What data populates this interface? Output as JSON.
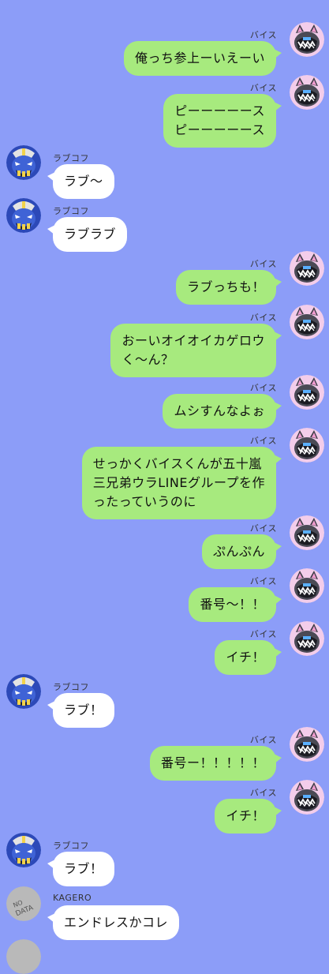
{
  "messages": [
    {
      "side": "right",
      "sender": "バイス",
      "avatar": "pink-cat-creature-icon",
      "text": "俺っち参上ーいえーい"
    },
    {
      "side": "right",
      "sender": "バイス",
      "avatar": "pink-cat-creature-icon",
      "text": "ピーーーーース\nピーーーーース"
    },
    {
      "side": "left",
      "sender": "ラブコフ",
      "avatar": "blue-kaiju-icon",
      "text": "ラブ〜"
    },
    {
      "side": "left",
      "sender": "ラブコフ",
      "avatar": "blue-kaiju-icon",
      "text": "ラブラブ"
    },
    {
      "side": "right",
      "sender": "バイス",
      "avatar": "pink-cat-creature-icon",
      "text": "ラブっちも！"
    },
    {
      "side": "right",
      "sender": "バイス",
      "avatar": "pink-cat-creature-icon",
      "text": "おーいオイオイカゲロウ\nく〜ん？"
    },
    {
      "side": "right",
      "sender": "バイス",
      "avatar": "pink-cat-creature-icon",
      "text": "ムシすんなよぉ"
    },
    {
      "side": "right",
      "sender": "バイス",
      "avatar": "pink-cat-creature-icon",
      "text": "せっかくバイスくんが五十嵐\n三兄弟ウラLINEグループを作\nったっていうのに"
    },
    {
      "side": "right",
      "sender": "バイス",
      "avatar": "pink-cat-creature-icon",
      "text": "ぷんぷん"
    },
    {
      "side": "right",
      "sender": "バイス",
      "avatar": "pink-cat-creature-icon",
      "text": "番号〜！！"
    },
    {
      "side": "right",
      "sender": "バイス",
      "avatar": "pink-cat-creature-icon",
      "text": "イチ！"
    },
    {
      "side": "left",
      "sender": "ラブコフ",
      "avatar": "blue-kaiju-icon",
      "text": "ラブ！"
    },
    {
      "side": "right",
      "sender": "バイス",
      "avatar": "pink-cat-creature-icon",
      "text": "番号ー！！！！！"
    },
    {
      "side": "right",
      "sender": "バイス",
      "avatar": "pink-cat-creature-icon",
      "text": "イチ！"
    },
    {
      "side": "left",
      "sender": "ラブコフ",
      "avatar": "blue-kaiju-icon",
      "text": "ラブ！"
    },
    {
      "side": "left",
      "sender": "KAGERO",
      "avatar": "no-data-icon",
      "avatar_text": [
        "NO",
        "DATA"
      ],
      "text": "エンドレスかコレ"
    }
  ],
  "colors": {
    "background": "#8c9df8",
    "outgoing_bubble": "#a7ea7e",
    "incoming_bubble": "#ffffff"
  }
}
